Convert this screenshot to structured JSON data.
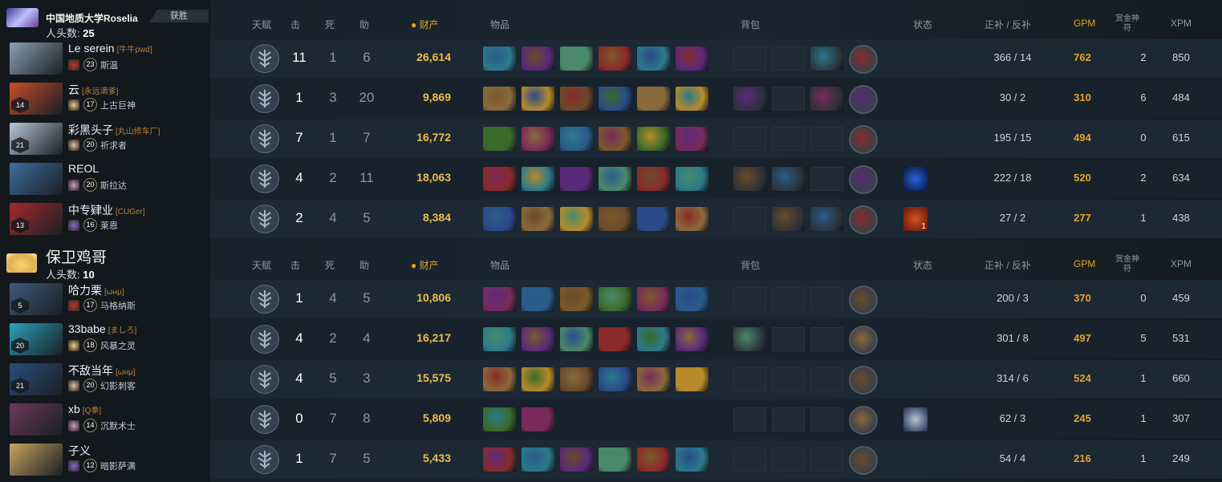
{
  "header_labels": {
    "talent": "天赋",
    "kills": "击",
    "deaths": "死",
    "assists": "助",
    "networth": "财产",
    "items": "物品",
    "backpack": "背包",
    "buffs": "状态",
    "lasthits": "正补 / 反补",
    "gpm": "GPM",
    "bounty": "赏金神符",
    "xpm": "XPM"
  },
  "teams": [
    {
      "name": "中国地质大学Roselia",
      "kills_label": "人头数:",
      "kills": "25",
      "result": "获胜",
      "players": [
        {
          "name": "Le serein",
          "tag": "[牛牛pwd]",
          "level": "",
          "hero_level": "23",
          "hero": "斯温",
          "k": "11",
          "d": "1",
          "a": "6",
          "networth": "26,614",
          "lh": "366 / 14",
          "gpm": "762",
          "bounty": "2",
          "xpm": "850"
        },
        {
          "name": "云",
          "tag": "[永远滴爹]",
          "level": "14",
          "hero_level": "17",
          "hero": "上古巨神",
          "k": "1",
          "d": "3",
          "a": "20",
          "networth": "9,869",
          "lh": "30 / 2",
          "gpm": "310",
          "bounty": "6",
          "xpm": "484"
        },
        {
          "name": "彩黑头子",
          "tag": "[丸山修车厂]",
          "level": "21",
          "hero_level": "20",
          "hero": "祈求者",
          "k": "7",
          "d": "1",
          "a": "7",
          "networth": "16,772",
          "lh": "195 / 15",
          "gpm": "494",
          "bounty": "0",
          "xpm": "615"
        },
        {
          "name": "REOL",
          "tag": "",
          "level": "",
          "hero_level": "20",
          "hero": "斯拉达",
          "k": "4",
          "d": "2",
          "a": "11",
          "networth": "18,063",
          "lh": "222 / 18",
          "gpm": "520",
          "bounty": "2",
          "xpm": "634"
        },
        {
          "name": "中专肄业",
          "tag": "[CUGer]",
          "level": "13",
          "hero_level": "16",
          "hero": "莱恩",
          "k": "2",
          "d": "4",
          "a": "5",
          "networth": "8,384",
          "lh": "27 / 2",
          "gpm": "277",
          "bounty": "1",
          "xpm": "438"
        }
      ]
    },
    {
      "name": "保卫鸡哥",
      "kills_label": "人头数:",
      "kills": "10",
      "result": "",
      "players": [
        {
          "name": "哈力栗",
          "tag": "[ωнμ]",
          "level": "5",
          "hero_level": "17",
          "hero": "马格纳斯",
          "k": "1",
          "d": "4",
          "a": "5",
          "networth": "10,806",
          "lh": "200 / 3",
          "gpm": "370",
          "bounty": "0",
          "xpm": "459"
        },
        {
          "name": "33babe",
          "tag": "[ましろ]",
          "level": "20",
          "hero_level": "18",
          "hero": "风暴之灵",
          "k": "4",
          "d": "2",
          "a": "4",
          "networth": "16,217",
          "lh": "301 / 8",
          "gpm": "497",
          "bounty": "5",
          "xpm": "531"
        },
        {
          "name": "不敌当年",
          "tag": "[ωнμ]",
          "level": "21",
          "hero_level": "20",
          "hero": "幻影刺客",
          "k": "4",
          "d": "5",
          "a": "3",
          "networth": "15,575",
          "lh": "314 / 6",
          "gpm": "524",
          "bounty": "1",
          "xpm": "660"
        },
        {
          "name": "xb",
          "tag": "[Q拳]",
          "level": "",
          "hero_level": "14",
          "hero": "沉默术士",
          "k": "0",
          "d": "7",
          "a": "8",
          "networth": "5,809",
          "lh": "62 / 3",
          "gpm": "245",
          "bounty": "1",
          "xpm": "307"
        },
        {
          "name": "子义",
          "tag": "",
          "level": "",
          "hero_level": "12",
          "hero": "暗影萨满",
          "k": "1",
          "d": "7",
          "a": "5",
          "networth": "5,433",
          "lh": "54 / 4",
          "gpm": "216",
          "bounty": "1",
          "xpm": "249"
        }
      ]
    }
  ],
  "buff_counts": [
    "1"
  ]
}
